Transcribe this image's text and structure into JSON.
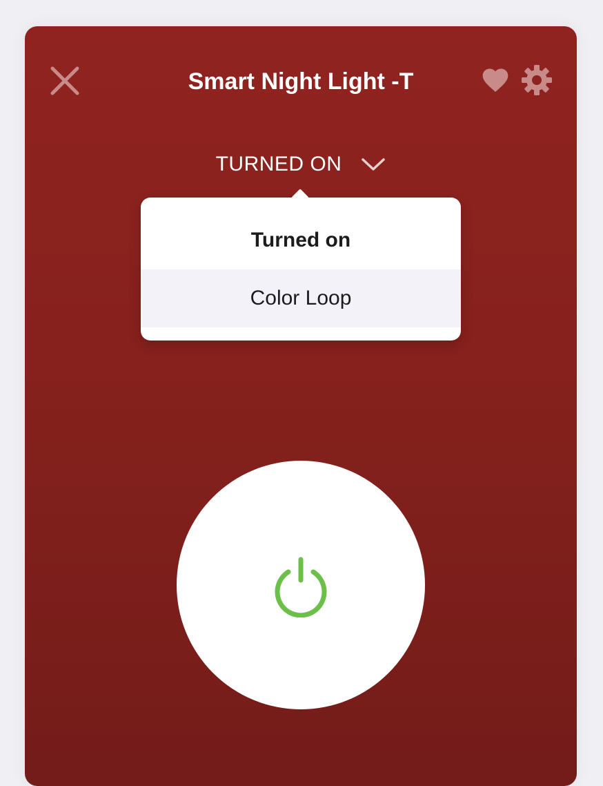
{
  "header": {
    "title": "Smart Night Light -T",
    "close_icon": "close-icon",
    "favorite_icon": "heart-icon",
    "settings_icon": "gear-icon"
  },
  "mode": {
    "current": "TURNED ON",
    "chevron_icon": "chevron-down-icon",
    "options": [
      "Turned on",
      "Color Loop"
    ],
    "selected": "Turned on"
  },
  "power": {
    "icon": "power-icon",
    "state": "on"
  },
  "colors": {
    "background": "#90231f",
    "icon_muted": "#c98b8a",
    "power_green": "#6cc04a",
    "highlight_row": "#f2f2f8",
    "page_bg": "#efeff4"
  }
}
